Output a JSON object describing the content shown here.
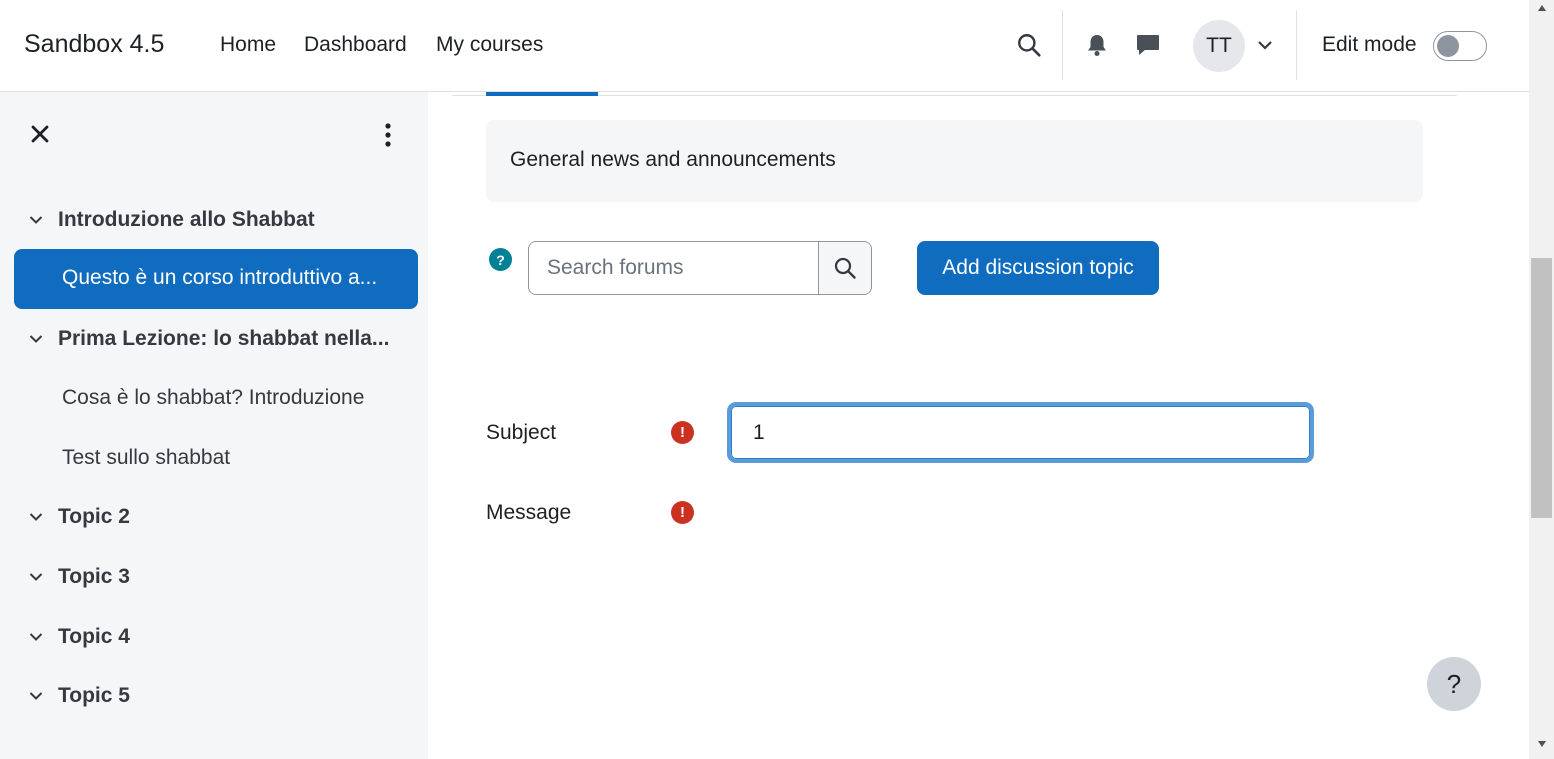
{
  "navbar": {
    "brand": "Sandbox 4.5",
    "links": [
      "Home",
      "Dashboard",
      "My courses"
    ],
    "avatar_initials": "TT",
    "edit_mode_label": "Edit mode",
    "edit_mode_on": false
  },
  "sidebar": {
    "sections": [
      {
        "label": "Introduzione allo Shabbat",
        "expanded": true
      },
      {
        "label": "Prima Lezione: lo shabbat nella...",
        "expanded": true
      },
      {
        "label": "Topic 2",
        "expanded": true
      },
      {
        "label": "Topic 3",
        "expanded": true
      },
      {
        "label": "Topic 4",
        "expanded": true
      },
      {
        "label": "Topic 5",
        "expanded": true
      }
    ],
    "activities": {
      "current": "Questo è un corso introduttivo a...",
      "lesson1_a": "Cosa è lo shabbat? Introduzione",
      "lesson1_b": "Test sullo shabbat"
    }
  },
  "main": {
    "intro": "General news and announcements",
    "search_placeholder": "Search forums",
    "add_button": "Add discussion topic",
    "form": {
      "subject_label": "Subject",
      "subject_value": "1",
      "message_label": "Message"
    },
    "help_label": "?"
  },
  "colors": {
    "primary": "#0f6cbf",
    "required": "#ca3120",
    "help": "#008196",
    "sidebar_bg": "#f5f6f8"
  }
}
